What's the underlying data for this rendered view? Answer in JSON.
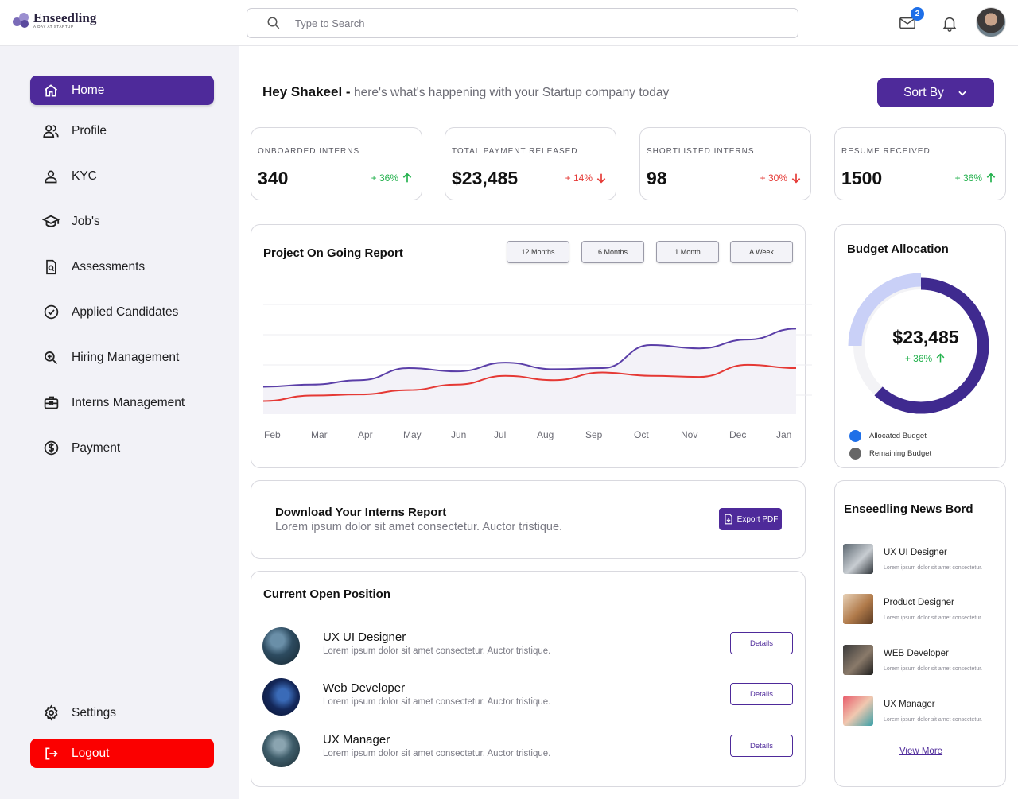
{
  "brand": {
    "name": "Enseedling",
    "tagline": "A DAY AT STARTUP"
  },
  "search": {
    "placeholder": "Type to Search"
  },
  "header": {
    "mail_badge": "2"
  },
  "sidebar": {
    "items": [
      {
        "label": "Home",
        "icon": "home-icon"
      },
      {
        "label": "Profile",
        "icon": "users-icon"
      },
      {
        "label": "KYC",
        "icon": "user-icon"
      },
      {
        "label": "Job's",
        "icon": "graduation-cap-icon"
      },
      {
        "label": "Assessments",
        "icon": "document-search-icon"
      },
      {
        "label": "Applied Candidates",
        "icon": "check-circle-icon"
      },
      {
        "label": "Hiring Management",
        "icon": "magnify-icon"
      },
      {
        "label": "Interns Management",
        "icon": "briefcase-icon"
      },
      {
        "label": "Payment",
        "icon": "dollar-circle-icon"
      }
    ],
    "settings_label": "Settings",
    "logout_label": "Logout"
  },
  "greeting": {
    "name": "Hey Shakeel -",
    "message": "here's what's happening with your Startup company today"
  },
  "sort": {
    "label": "Sort By"
  },
  "stats": [
    {
      "label": "ONBOARDED INTERNS",
      "value": "340",
      "change": "+ 36%",
      "trend": "up"
    },
    {
      "label": "TOTAL PAYMENT RELEASED",
      "value": "$23,485",
      "change": "+ 14%",
      "trend": "down"
    },
    {
      "label": "SHORTLISTED INTERNS",
      "value": "98",
      "change": "+ 30%",
      "trend": "down"
    },
    {
      "label": "RESUME RECEIVED",
      "value": "1500",
      "change": "+ 36%",
      "trend": "up"
    }
  ],
  "report": {
    "title": "Project On Going Report",
    "ranges": [
      "12 Months",
      "6 Months",
      "1 Month",
      "A Week"
    ]
  },
  "chart_data": {
    "type": "line",
    "categories": [
      "Feb",
      "Mar",
      "Apr",
      "May",
      "Jun",
      "Jul",
      "Aug",
      "Sep",
      "Oct",
      "Nov",
      "Dec",
      "Jan"
    ],
    "series": [
      {
        "values": [
          25,
          27,
          31,
          42,
          39,
          47,
          41,
          42,
          63,
          60,
          68,
          78
        ],
        "color": "#5b3fa8"
      },
      {
        "values": [
          12,
          17,
          18,
          22,
          27,
          35,
          31,
          38,
          35,
          34,
          45,
          42
        ],
        "color": "#e53935"
      }
    ],
    "grid": true,
    "ylim": [
      0,
      100
    ]
  },
  "budget": {
    "title": "Budget Allocation",
    "value": "$23,485",
    "change": "+ 36%",
    "allocated_fraction": 0.62,
    "legend": [
      {
        "label": "Allocated Budget",
        "color": "#1e6fe8"
      },
      {
        "label": "Remaining Budget",
        "color": "#666666"
      }
    ],
    "colors": {
      "allocated": "#3f2a8f",
      "remaining": "#c9d0f7",
      "track": "#f3f3f6"
    }
  },
  "download": {
    "title": "Download Your Interns Report",
    "subtitle": "Lorem ipsum dolor sit amet consectetur. Auctor tristique.",
    "button": "Export PDF"
  },
  "positions": {
    "title": "Current Open Position",
    "items": [
      {
        "title": "UX UI Designer",
        "desc": "Lorem ipsum dolor sit amet consectetur. Auctor tristique.",
        "button": "Details"
      },
      {
        "title": "Web Developer",
        "desc": "Lorem ipsum dolor sit amet consectetur. Auctor tristique.",
        "button": "Details"
      },
      {
        "title": "UX Manager",
        "desc": "Lorem ipsum dolor sit amet consectetur. Auctor tristique.",
        "button": "Details"
      }
    ]
  },
  "news": {
    "title": "Enseedling News Bord",
    "items": [
      {
        "title": "UX UI Designer",
        "desc": "Lorem ipsum dolor sit amet consectetur."
      },
      {
        "title": "Product Designer",
        "desc": "Lorem ipsum dolor sit amet consectetur."
      },
      {
        "title": "WEB Developer",
        "desc": "Lorem ipsum dolor sit amet consectetur."
      },
      {
        "title": "UX Manager",
        "desc": "Lorem ipsum dolor sit amet consectetur."
      }
    ],
    "view_more": "View More"
  }
}
